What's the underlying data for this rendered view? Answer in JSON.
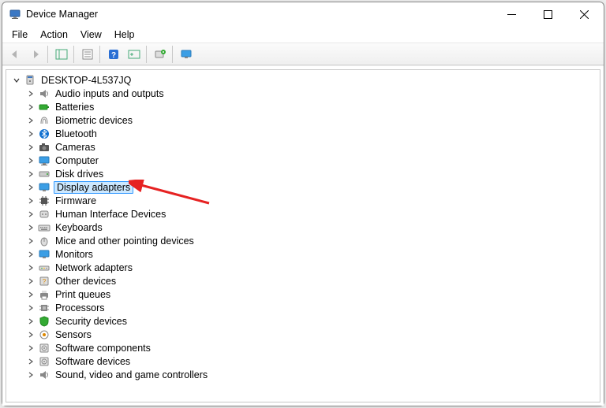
{
  "window": {
    "title": "Device Manager"
  },
  "menubar": {
    "file": "File",
    "action": "Action",
    "view": "View",
    "help": "Help"
  },
  "tree": {
    "root_label": "DESKTOP-4L537JQ",
    "items": [
      {
        "label": "Audio inputs and outputs",
        "icon": "speaker"
      },
      {
        "label": "Batteries",
        "icon": "battery"
      },
      {
        "label": "Biometric devices",
        "icon": "fingerprint"
      },
      {
        "label": "Bluetooth",
        "icon": "bluetooth"
      },
      {
        "label": "Cameras",
        "icon": "camera"
      },
      {
        "label": "Computer",
        "icon": "computer"
      },
      {
        "label": "Disk drives",
        "icon": "disk"
      },
      {
        "label": "Display adapters",
        "icon": "display",
        "selected": true
      },
      {
        "label": "Firmware",
        "icon": "chip"
      },
      {
        "label": "Human Interface Devices",
        "icon": "hid"
      },
      {
        "label": "Keyboards",
        "icon": "keyboard"
      },
      {
        "label": "Mice and other pointing devices",
        "icon": "mouse"
      },
      {
        "label": "Monitors",
        "icon": "monitor"
      },
      {
        "label": "Network adapters",
        "icon": "network"
      },
      {
        "label": "Other devices",
        "icon": "other"
      },
      {
        "label": "Print queues",
        "icon": "printer"
      },
      {
        "label": "Processors",
        "icon": "cpu"
      },
      {
        "label": "Security devices",
        "icon": "security"
      },
      {
        "label": "Sensors",
        "icon": "sensor"
      },
      {
        "label": "Software components",
        "icon": "software"
      },
      {
        "label": "Software devices",
        "icon": "software"
      },
      {
        "label": "Sound, video and game controllers",
        "icon": "speaker"
      }
    ]
  },
  "annotation": {
    "arrow_color": "#e62222"
  }
}
